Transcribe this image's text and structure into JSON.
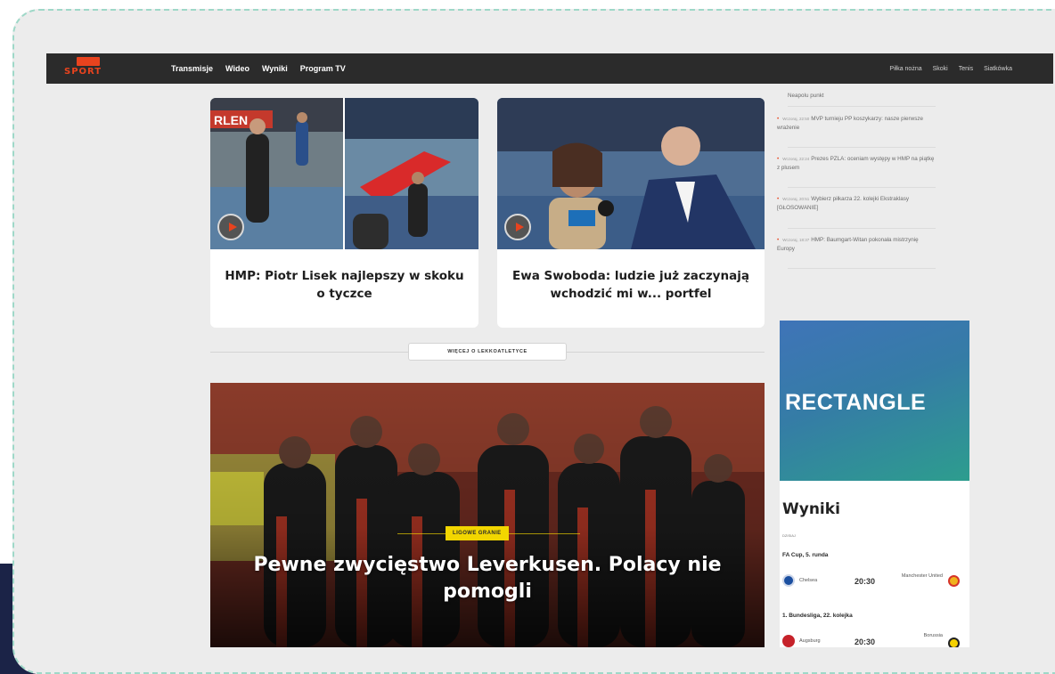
{
  "nav": {
    "logo_text": "SPORT",
    "main": [
      "Transmisje",
      "Wideo",
      "Wyniki",
      "Program TV"
    ],
    "right": [
      "Piłka nożna",
      "Skoki",
      "Tenis",
      "Siatkówka"
    ]
  },
  "cards": [
    {
      "title": "HMP: Piotr Lisek najlepszy w skoku o tyczce"
    },
    {
      "title": "Ewa Swoboda: ludzie już zaczynają wchodzić mi w... portfel"
    }
  ],
  "more_button": "WIĘCEJ O LEKKOATLETYCE",
  "hero": {
    "tag": "LIGOWE GRANIE",
    "title": "Pewne zwycięstwo Leverkusen. Polacy nie pomogli"
  },
  "news": [
    {
      "time": "",
      "text": "Neapolu punkt"
    },
    {
      "time": "Wczoraj, 22:50",
      "text": "MVP turnieju PP koszykarzy: nasze pierwsze wrażenie"
    },
    {
      "time": "Wczoraj, 22:24",
      "text": "Prezes PZLA: oceniam występy w HMP na piątkę z plusem"
    },
    {
      "time": "Wczoraj, 20:51",
      "text": "Wybierz piłkarza 22. kolejki Ekstraklasy [GŁOSOWANIE]"
    },
    {
      "time": "Wczoraj, 18:37",
      "text": "HMP: Baumgart-Witan pokonała mistrzynię Europy"
    }
  ],
  "ad_label": "RECTANGLE",
  "results": {
    "title": "Wyniki",
    "day": "DZISIAJ",
    "league1": "FA Cup, 5. runda",
    "match1": {
      "home": "Chelsea",
      "time": "20:30",
      "away": "Manchester United"
    },
    "league2": "1. Bundesliga, 22. kolejka",
    "match2": {
      "home": "Augsburg",
      "time": "20:30",
      "away": "Borussia"
    }
  },
  "colors": {
    "nav_bg": "#2b2b2b",
    "brand": "#e8431e",
    "tag": "#f2d600",
    "ad_gradient_start": "#3f74b8",
    "ad_gradient_end": "#2d9d8e"
  }
}
